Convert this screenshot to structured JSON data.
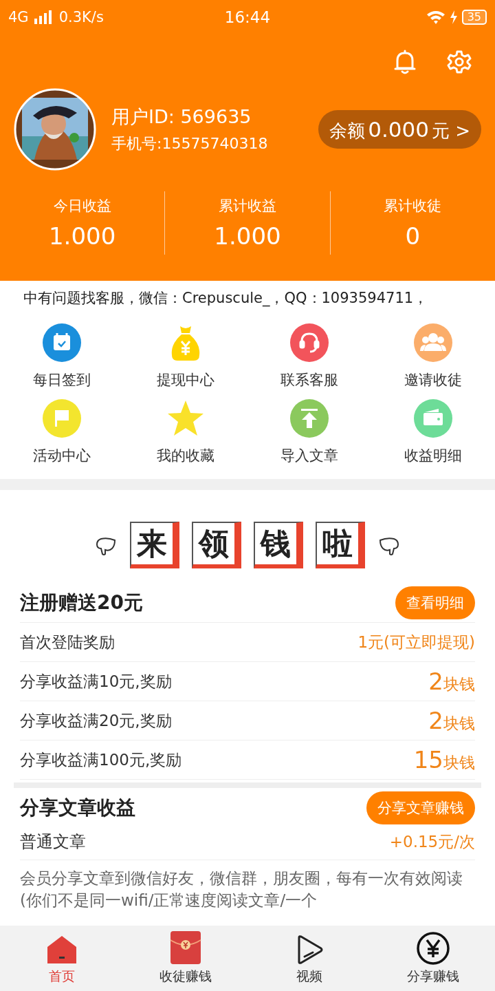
{
  "status_bar": {
    "network": "4G",
    "speed": "0.3K/s",
    "time": "16:44",
    "battery": "35"
  },
  "header": {
    "user_id": "用户ID: 569635",
    "phone": "手机号:15575740318",
    "balance_label": "余额",
    "balance": "0.000",
    "balance_unit": "元 >"
  },
  "stats": [
    {
      "label": "今日收益",
      "value": "1.000"
    },
    {
      "label": "累计收益",
      "value": "1.000"
    },
    {
      "label": "累计收徒",
      "value": "0"
    }
  ],
  "notice": "中有问题找客服，微信：Crepuscule_，QQ：1093594711，",
  "menu": [
    {
      "label": "每日签到",
      "kind": "calendar",
      "color": "#1a8fdc"
    },
    {
      "label": "提现中心",
      "kind": "moneybag",
      "color": "#ffd400"
    },
    {
      "label": "联系客服",
      "kind": "headset",
      "color": "#f2545b"
    },
    {
      "label": "邀请收徒",
      "kind": "people",
      "color": "#fbad6a"
    },
    {
      "label": "活动中心",
      "kind": "flag",
      "color": "#f3e52e"
    },
    {
      "label": "我的收藏",
      "kind": "star",
      "color": "#f9e12a"
    },
    {
      "label": "导入文章",
      "kind": "upload",
      "color": "#8bc95d"
    },
    {
      "label": "收益明细",
      "kind": "wallet",
      "color": "#6ddc98"
    }
  ],
  "banner": {
    "chars": [
      "来",
      "领",
      "钱",
      "啦"
    ]
  },
  "rewards": {
    "title": "注册赠送20元",
    "button": "查看明细",
    "rows": [
      {
        "label": "首次登陆奖励",
        "kind": "plain",
        "amount": "1元(可立即提现)"
      },
      {
        "label": "分享收益满10元,奖励",
        "kind": "big",
        "amount": "2",
        "unit": "块钱"
      },
      {
        "label": "分享收益满20元,奖励",
        "kind": "big",
        "amount": "2",
        "unit": "块钱"
      },
      {
        "label": "分享收益满100元,奖励",
        "kind": "big",
        "amount": "15",
        "unit": "块钱"
      }
    ]
  },
  "article": {
    "title": "分享文章收益",
    "button": "分享文章赚钱",
    "type": "普通文章",
    "rate": "+0.15元/次",
    "description": "会员分享文章到微信好友，微信群，朋友圈，每有一次有效阅读(你们不是同一wifi/正常速度阅读文章/一个"
  },
  "tabs": [
    {
      "label": "首页",
      "kind": "home",
      "selected": true
    },
    {
      "label": "收徒赚钱",
      "kind": "envelope",
      "selected": false
    },
    {
      "label": "视频",
      "kind": "play",
      "selected": false
    },
    {
      "label": "分享赚钱",
      "kind": "yuan",
      "selected": false
    }
  ]
}
